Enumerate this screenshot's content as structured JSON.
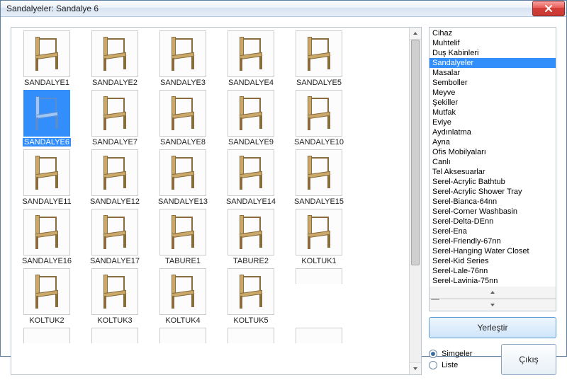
{
  "window": {
    "title": "Sandalyeler:  Sandalye 6"
  },
  "grid": {
    "selected_index": 5,
    "items": [
      {
        "label": "SANDALYE1"
      },
      {
        "label": "SANDALYE2"
      },
      {
        "label": "SANDALYE3"
      },
      {
        "label": "SANDALYE4"
      },
      {
        "label": "SANDALYE5"
      },
      {
        "label": "SANDALYE6"
      },
      {
        "label": "SANDALYE7"
      },
      {
        "label": "SANDALYE8"
      },
      {
        "label": "SANDALYE9"
      },
      {
        "label": "SANDALYE10"
      },
      {
        "label": "SANDALYE11"
      },
      {
        "label": "SANDALYE12"
      },
      {
        "label": "SANDALYE13"
      },
      {
        "label": "SANDALYE14"
      },
      {
        "label": "SANDALYE15"
      },
      {
        "label": "SANDALYE16"
      },
      {
        "label": "SANDALYE17"
      },
      {
        "label": "TABURE1"
      },
      {
        "label": "TABURE2"
      },
      {
        "label": "KOLTUK1"
      },
      {
        "label": "KOLTUK2"
      },
      {
        "label": "KOLTUK3"
      },
      {
        "label": "KOLTUK4"
      },
      {
        "label": "KOLTUK5"
      }
    ],
    "partial_row_count": 6
  },
  "categories": {
    "selected_index": 3,
    "items": [
      "Cihaz",
      "Muhtelif",
      "Duş Kabinleri",
      "Sandalyeler",
      "Masalar",
      "Semboller",
      "Meyve",
      "Şekiller",
      "Mutfak",
      "Eviye",
      "Aydınlatma",
      "Ayna",
      "Ofis Mobilyaları",
      "Canlı",
      "Tel Aksesuarlar",
      "Serel-Acrylic Bathtub",
      "Serel-Acrylic Shower Tray",
      "Serel-Bianca-64nn",
      "Serel-Corner Washbasin",
      "Serel-Delta-DEnn",
      "Serel-Ena",
      "Serel-Friendly-67nn",
      "Serel-Hanging Water Closet",
      "Serel-Kid Series",
      "Serel-Lale-76nn",
      "Serel-Lavinia-75nn"
    ]
  },
  "buttons": {
    "place": "Yerleştir",
    "quit": "Çıkış"
  },
  "view_mode": {
    "option_icons": "Simgeler",
    "option_list": "Liste",
    "selected": "icons"
  }
}
